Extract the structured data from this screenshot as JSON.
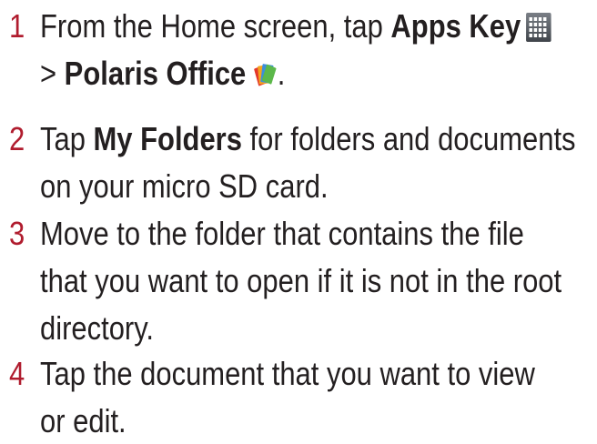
{
  "steps": [
    {
      "number": "1",
      "line1_prefix": "From the Home screen, tap ",
      "line1_bold": "Apps Key",
      "line2_prefix": "> ",
      "line2_bold": "Polaris Office",
      "line2_suffix": ".",
      "icons": [
        "apps-grid-icon",
        "polaris-office-icon"
      ]
    },
    {
      "number": "2",
      "line1_prefix": "Tap ",
      "line1_bold": "My Folders",
      "line1_suffix": " for folders and documents",
      "line2": "on your micro SD card."
    },
    {
      "number": "3",
      "line1": "Move to the folder that contains the file",
      "line2": "that you want to open if it is not in the root",
      "line3": "directory."
    },
    {
      "number": "4",
      "line1": "Tap the document that you want to view",
      "line2": "or edit."
    }
  ],
  "colors": {
    "step_number": "#b01c2e",
    "text": "#231f20"
  }
}
